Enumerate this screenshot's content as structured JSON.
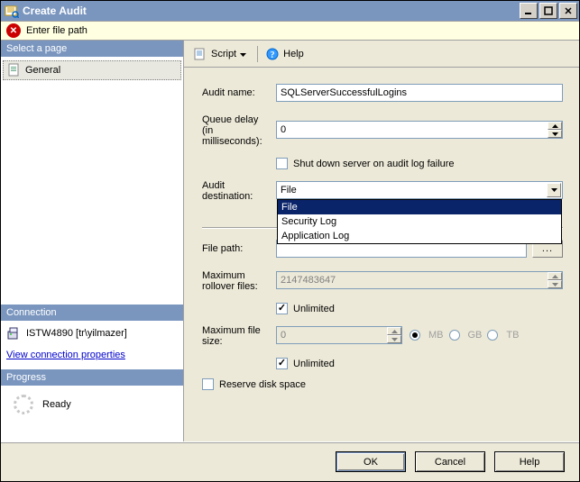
{
  "window": {
    "title": "Create Audit"
  },
  "ribbon": {
    "text": "Enter file path"
  },
  "sidebar": {
    "select_page_header": "Select a page",
    "general_item": "General",
    "connection_header": "Connection",
    "server_label": "ISTW4890 [tr\\yilmazer]",
    "view_conn_link": "View connection properties",
    "progress_header": "Progress",
    "progress_status": "Ready"
  },
  "toolbar": {
    "script_label": "Script",
    "help_label": "Help"
  },
  "form": {
    "audit_name_label": "Audit name:",
    "audit_name_value": "SQLServerSuccessfulLogins",
    "queue_delay_label": "Queue delay (in milliseconds):",
    "queue_delay_value": "0",
    "shutdown_label": "Shut down server on audit log failure",
    "audit_dest_label": "Audit destination:",
    "audit_dest_value": "File",
    "audit_dest_options": {
      "o0": "File",
      "o1": "Security Log",
      "o2": "Application Log"
    },
    "file_path_label": "File path:",
    "file_path_value": "",
    "browse_label": "...",
    "max_rollover_label": "Maximum rollover files:",
    "max_rollover_value": "2147483647",
    "unlimited_label": "Unlimited",
    "max_size_label": "Maximum file size:",
    "max_size_value": "0",
    "unit_mb": "MB",
    "unit_gb": "GB",
    "unit_tb": "TB",
    "reserve_label": "Reserve disk space"
  },
  "footer": {
    "ok": "OK",
    "cancel": "Cancel",
    "help": "Help"
  }
}
